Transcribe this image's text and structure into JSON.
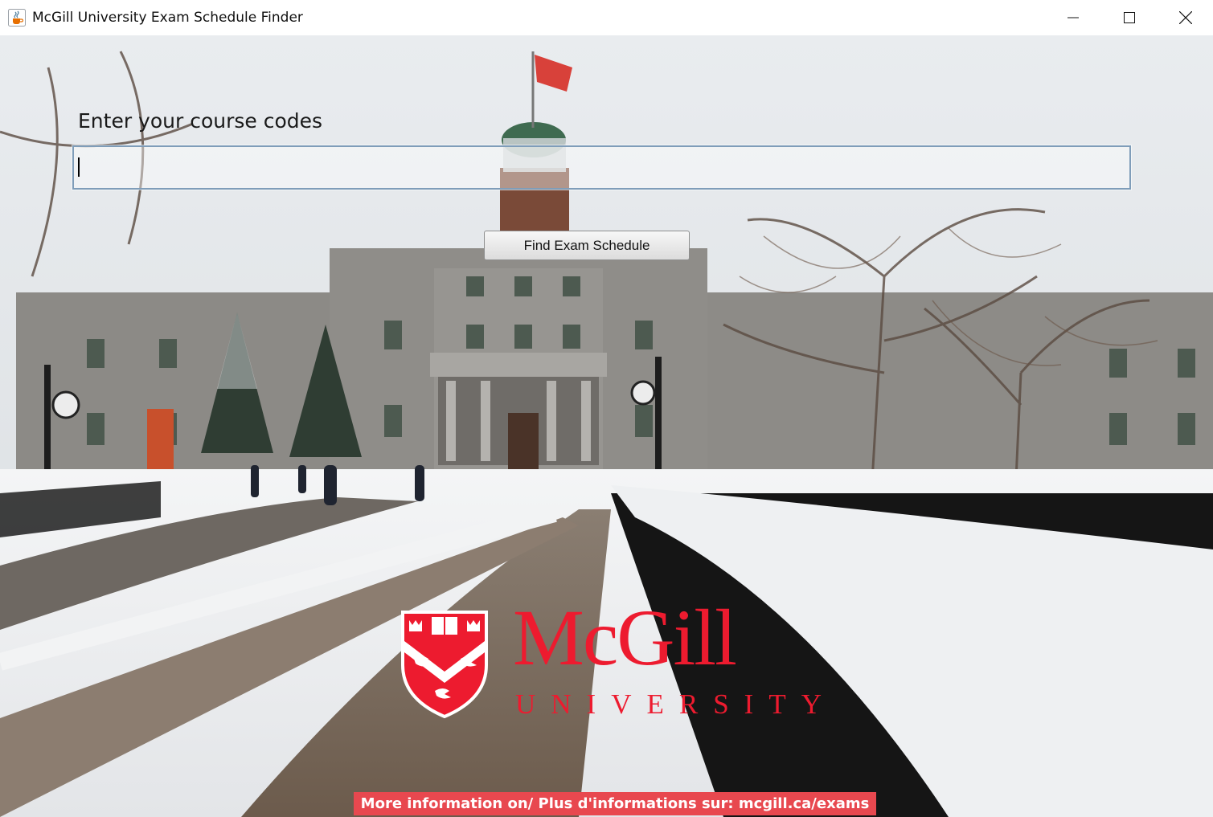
{
  "window": {
    "title": "McGill University Exam Schedule Finder",
    "app_icon": "java-cup-icon",
    "controls": [
      "minimize",
      "maximize",
      "close"
    ]
  },
  "form": {
    "prompt": "Enter your course codes",
    "course_input": {
      "value": "",
      "placeholder": ""
    },
    "submit_label": "Find Exam Schedule"
  },
  "logo": {
    "wordmark": "McGill",
    "subtitle": "UNIVERSITY",
    "shield_icon": "mcgill-crest-icon"
  },
  "footer": {
    "info": "More information on/ Plus d'informations sur: mcgill.ca/exams"
  },
  "colors": {
    "brand_red": "#ed1b2f",
    "banner_red": "#e8484f",
    "input_border": "#7f9db9"
  }
}
